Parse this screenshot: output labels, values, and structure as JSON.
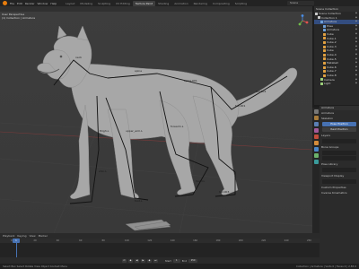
{
  "app": {
    "menus": [
      "File",
      "Edit",
      "Render",
      "Window",
      "Help"
    ],
    "tabs": [
      "Layout",
      "Modeling",
      "Sculpting",
      "UV Editing",
      "Texture Paint",
      "Shading",
      "Animation",
      "Rendering",
      "Compositing",
      "Scripting"
    ],
    "active_tab_index": 4,
    "scene_name": "Scene",
    "view_layer": "ViewLayer"
  },
  "viewport": {
    "info_line1": "User Perspective",
    "info_line2": "(1) Collection | Armature",
    "bone_labels": [
      "neck",
      "spine",
      "spine.001",
      "thigh.L",
      "shin.L",
      "foot.L",
      "upper_arm.L",
      "forearm.L",
      "hand.L",
      "tail.001",
      "tail.002",
      "tail.003"
    ]
  },
  "outliner": {
    "header": "Scene Collection",
    "rows": [
      {
        "label": "Scene Collection",
        "indent": 0,
        "color": "#c9c9c9"
      },
      {
        "label": "Collection 1",
        "indent": 1,
        "color": "#c9c9c9"
      },
      {
        "label": "Armature",
        "indent": 2,
        "color": "#6fa0d8"
      },
      {
        "label": "Pose",
        "indent": 3,
        "color": "#6fa0d8"
      },
      {
        "label": "Armature",
        "indent": 3,
        "color": "#6fa0d8"
      },
      {
        "label": "Cube",
        "indent": 3,
        "color": "#e0a040"
      },
      {
        "label": "Cube.1",
        "indent": 3,
        "color": "#e0a040"
      },
      {
        "label": "Cube.2",
        "indent": 3,
        "color": "#e0a040"
      },
      {
        "label": "Cube.3",
        "indent": 3,
        "color": "#e0a040"
      },
      {
        "label": "Cube",
        "indent": 3,
        "color": "#e0a040"
      },
      {
        "label": "Cube.4",
        "indent": 3,
        "color": "#e0a040"
      },
      {
        "label": "Cube.5",
        "indent": 3,
        "color": "#e0a040"
      },
      {
        "label": "Metaball",
        "indent": 3,
        "color": "#e0a040"
      },
      {
        "label": "Cube.6",
        "indent": 3,
        "color": "#e0a040"
      },
      {
        "label": "Cube.7",
        "indent": 3,
        "color": "#e0a040"
      },
      {
        "label": "Cube.8",
        "indent": 3,
        "color": "#e0a040"
      },
      {
        "label": "Camera",
        "indent": 2,
        "color": "#9ccf7a"
      },
      {
        "label": "Light",
        "indent": 2,
        "color": "#9ccf7a"
      }
    ],
    "selected_index": 2
  },
  "properties": {
    "header": "Armature",
    "rows": [
      "Armature",
      "Skeleton",
      "Pose Position",
      "Rest Position",
      "Layers",
      "Bone Groups",
      "Pose Library",
      "Viewport Display",
      "Custom Properties",
      "Inverse Kinematics"
    ],
    "btn_pose": "Pose Position",
    "btn_rest": "Rest Position"
  },
  "timeline": {
    "menu": [
      "Playback",
      "Keying",
      "View",
      "Marker"
    ],
    "frame_numbers": [
      "0",
      "20",
      "40",
      "60",
      "80",
      "100",
      "120",
      "140",
      "160",
      "180",
      "200",
      "220",
      "240",
      "250"
    ],
    "current_frame": "1",
    "start_label": "Start",
    "start": "1",
    "end_label": "End",
    "end": "250"
  },
  "statusbar": {
    "left": "Select   Box Select   Rotate View   Object Context Menu",
    "right": "Collection | Armature | Verts 0 | Faces 0 | 2.83.0"
  },
  "colors": {
    "accent": "#4772b3",
    "bone": "#111111",
    "model": "#a9a9a9"
  }
}
